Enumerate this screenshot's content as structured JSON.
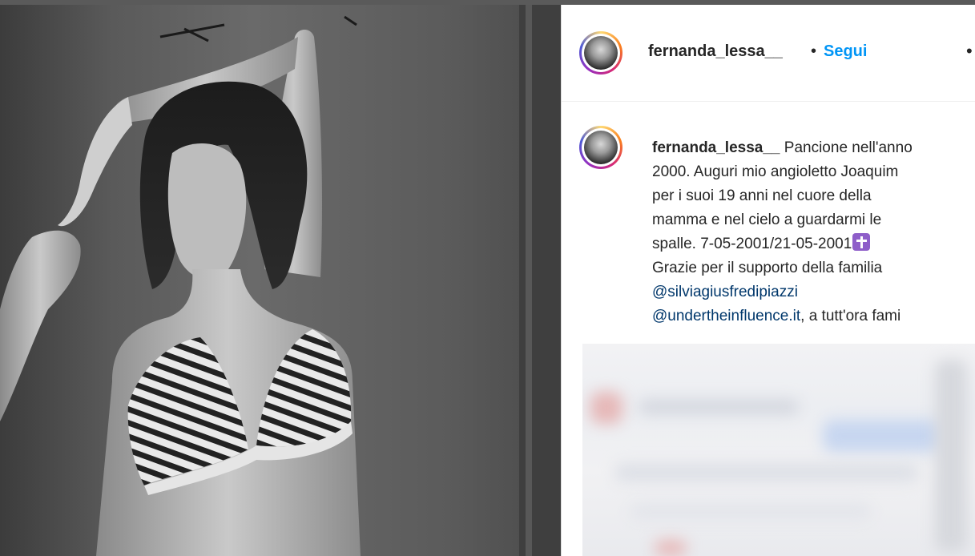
{
  "photo": {
    "icon": "portrait-photo",
    "alt_tone": "black-and-white"
  },
  "header": {
    "username": "fernanda_lessa__",
    "separator": "•",
    "follow_label": "Segui",
    "more_icon": "ellipsis-icon"
  },
  "caption": {
    "username": "fernanda_lessa__",
    "line1_text": " Pancione nell'anno",
    "line2": "2000. Auguri mio angioletto Joaquim",
    "line3": "per i suoi 19 anni nel cuore della",
    "line4": "mamma e nel cielo a guardarmi le",
    "line5": "spalle. 7-05-2001/21-05-2001",
    "cross_emoji": "✝️",
    "line6": "Grazie per il supporto della familia",
    "mention1": "@silviagiusfredipiazzi",
    "mention2": "@undertheinfluence.it",
    "line8_rest": ", a tutt'ora fami"
  },
  "colors": {
    "follow_blue": "#0095f6",
    "mention_blue": "#00376b",
    "text": "#262626"
  }
}
